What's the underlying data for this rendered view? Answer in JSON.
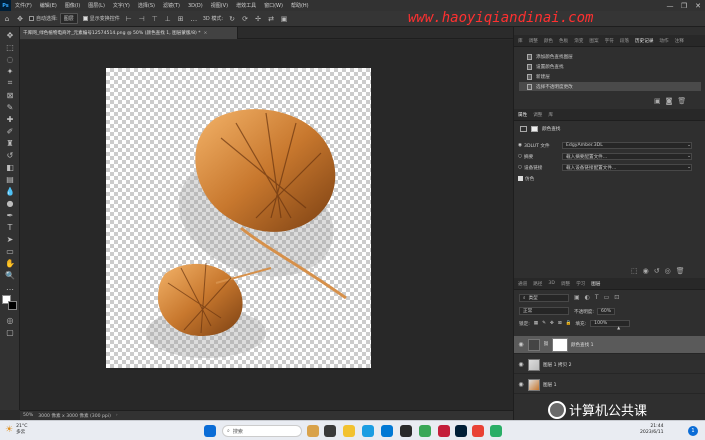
{
  "app": {
    "logo": "Ps",
    "menus": [
      "文件(F)",
      "编辑(E)",
      "图像(I)",
      "图层(L)",
      "文字(Y)",
      "选择(S)",
      "滤镜(T)",
      "3D(D)",
      "视图(V)",
      "增效工具",
      "窗口(W)",
      "帮助(H)"
    ],
    "window_controls": [
      "—",
      "❐",
      "✕"
    ]
  },
  "options_bar": {
    "auto_select_label": "自动选择:",
    "auto_select_value": "图层",
    "show_transform_label": "显示变换控件",
    "mode_3d_label": "3D 模式:"
  },
  "watermark": "www.haoyiqiandinai.com",
  "document": {
    "tab_title": "千库网_绿色植物电商叶_元素编号12574514.png @ 50% (颜色查找 1, 图层蒙版/8) *",
    "status_zoom": "50%",
    "status_info": "3000 像素 x 3000 像素 (300 ppi)"
  },
  "history_panel": {
    "tabs": [
      "库",
      "调整",
      "颜色",
      "色板",
      "渐变",
      "图案",
      "字符",
      "段落",
      "历史记录",
      "动作",
      "注释"
    ],
    "active_tab": "历史记录",
    "items": [
      {
        "label": "添加颜色查找图层",
        "selected": false
      },
      {
        "label": "设置颜色查找",
        "selected": false
      },
      {
        "label": "新建层",
        "selected": false
      },
      {
        "label": "选择不透明度更改",
        "selected": true
      }
    ]
  },
  "properties_panel": {
    "tabs": [
      "属性",
      "调整",
      "库"
    ],
    "active_tab": "属性",
    "section_title": "颜色查找",
    "rows": [
      {
        "label": "3DLUT 文件",
        "value": "EdgyAmber.3DL",
        "checked": true
      },
      {
        "label": "摘要",
        "value": "载入摘要配置文件...",
        "checked": false
      },
      {
        "label": "设备链接",
        "value": "载入设备链接配置文件...",
        "checked": false
      },
      {
        "label": "仿色",
        "value": "",
        "checked": true
      }
    ]
  },
  "layers_panel": {
    "tabs": [
      "通道",
      "路径",
      "3D",
      "调整",
      "学习",
      "图层"
    ],
    "active_tab": "图层",
    "filter_label": "类型",
    "blend_mode": "正常",
    "opacity_label": "不透明度:",
    "opacity_value": "60%",
    "lock_label": "锁定:",
    "fill_label": "填充:",
    "fill_value": "100%",
    "layers": [
      {
        "name": "颜色查找 1",
        "selected": true
      },
      {
        "name": "图层 1 拷贝 2",
        "selected": false
      },
      {
        "name": "图层 1",
        "selected": false
      }
    ]
  },
  "taskbar": {
    "weather_temp": "21°C",
    "weather_desc": "多云",
    "search_placeholder": "搜索",
    "time": "21:44",
    "date": "2023/6/11",
    "notification_count": "1"
  },
  "brand_overlay": "计算机公共课",
  "colors": {
    "ps_blue": "#31a8ff",
    "watermark_red": "#ff3030",
    "leaf_gold": "#c8782e"
  }
}
